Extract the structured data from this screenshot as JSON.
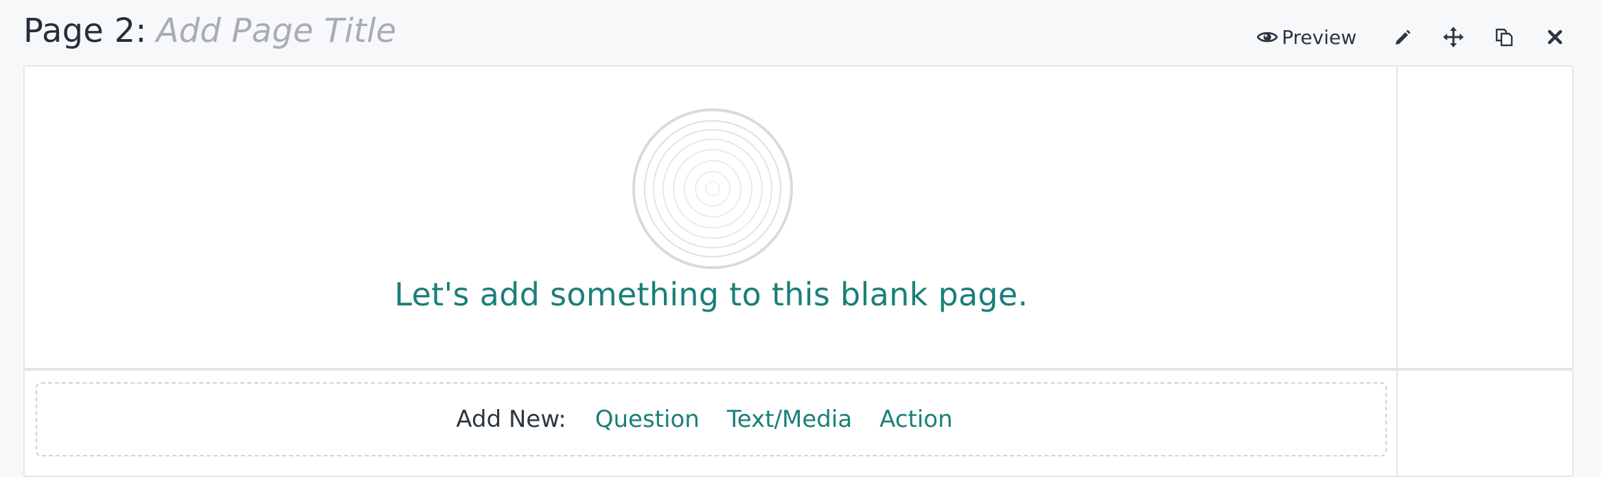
{
  "header": {
    "page_label": "Page 2:",
    "title_placeholder": "Add Page Title"
  },
  "toolbar": {
    "preview_label": "Preview",
    "icons": [
      "eye-icon",
      "pencil-icon",
      "move-icon",
      "copy-icon",
      "close-icon"
    ]
  },
  "empty_state": {
    "icon": "target-icon",
    "message": "Let's add something to this blank page."
  },
  "add_new": {
    "label": "Add New:",
    "options": [
      "Question",
      "Text/Media",
      "Action"
    ]
  },
  "colors": {
    "accent": "#1a7f78",
    "text_dark": "#262e3a",
    "placeholder": "#a9adb3",
    "background": "#f7f8fa",
    "panel_border": "#e3e5e8"
  }
}
